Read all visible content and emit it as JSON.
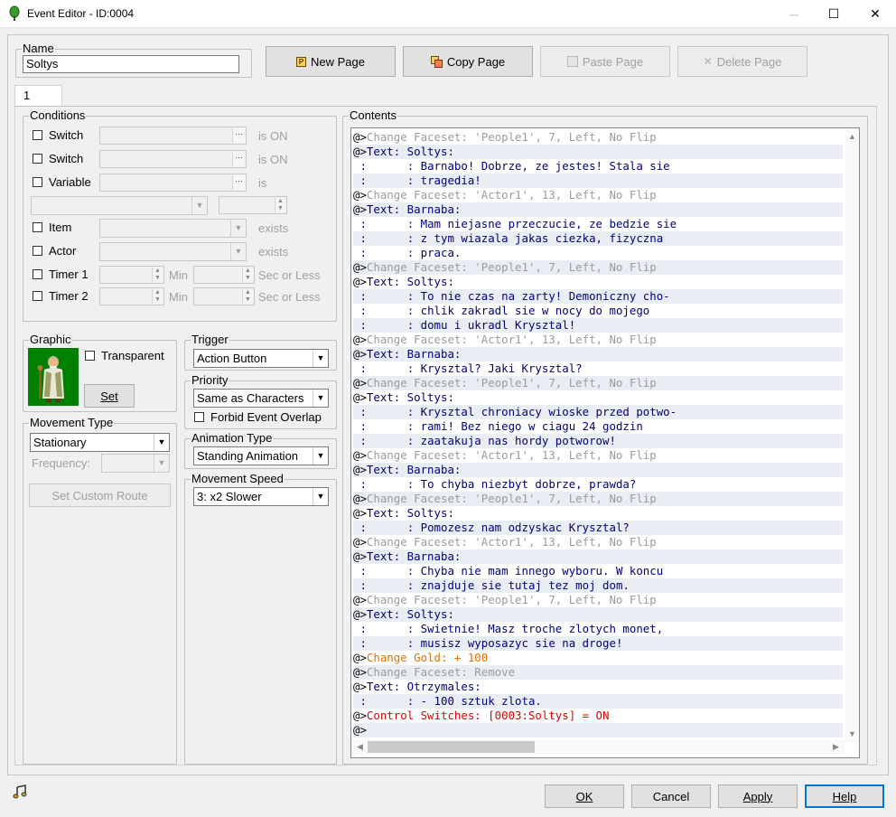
{
  "window": {
    "title": "Event Editor - ID:0004",
    "min": "─",
    "max": "☐",
    "close": "✕"
  },
  "name": {
    "label": "Name",
    "value": "Soltys"
  },
  "toolbar": {
    "new_page": "New Page",
    "copy_page": "Copy Page",
    "paste_page": "Paste Page",
    "delete_page": "Delete Page"
  },
  "tabs": [
    "1"
  ],
  "conditions": {
    "label": "Conditions",
    "switch": "Switch",
    "is_on": "is ON",
    "variable": "Variable",
    "is": "is",
    "item": "Item",
    "exists": "exists",
    "actor": "Actor",
    "timer1": "Timer 1",
    "timer2": "Timer 2",
    "min": "Min",
    "sec": "Sec or Less"
  },
  "graphic": {
    "label": "Graphic",
    "transparent": "Transparent",
    "set": "Set"
  },
  "trigger": {
    "label": "Trigger",
    "value": "Action Button"
  },
  "priority": {
    "label": "Priority",
    "value": "Same as Characters",
    "forbid": "Forbid Event Overlap"
  },
  "animation": {
    "label": "Animation Type",
    "value": "Standing Animation"
  },
  "speed": {
    "label": "Movement Speed",
    "value": "3: x2 Slower"
  },
  "movement": {
    "label": "Movement Type",
    "value": "Stationary",
    "frequency": "Frequency:",
    "custom_route": "Set Custom Route"
  },
  "contents": {
    "label": "Contents",
    "lines": [
      [
        "@>",
        "Change Faceset: 'People1', 7, Left, No Flip",
        "g"
      ],
      [
        "@>",
        "Text: Soltys:",
        "t"
      ],
      [
        " :      ",
        ": Barnabo! Dobrze, ze jestes! Stala sie",
        "t"
      ],
      [
        " :      ",
        ": tragedia!",
        "t"
      ],
      [
        "@>",
        "Change Faceset: 'Actor1', 13, Left, No Flip",
        "g"
      ],
      [
        "@>",
        "Text: Barnaba:",
        "t"
      ],
      [
        " :      ",
        ": Mam niejasne przeczucie, ze bedzie sie",
        "t"
      ],
      [
        " :      ",
        ": z tym wiazala jakas ciezka, fizyczna",
        "t"
      ],
      [
        " :      ",
        ": praca.",
        "t"
      ],
      [
        "@>",
        "Change Faceset: 'People1', 7, Left, No Flip",
        "g"
      ],
      [
        "@>",
        "Text: Soltys:",
        "t"
      ],
      [
        " :      ",
        ": To nie czas na zarty! Demoniczny cho-",
        "t"
      ],
      [
        " :      ",
        ": chlik zakradl sie w nocy do mojego",
        "t"
      ],
      [
        " :      ",
        ": domu i ukradl Krysztal!",
        "t"
      ],
      [
        "@>",
        "Change Faceset: 'Actor1', 13, Left, No Flip",
        "g"
      ],
      [
        "@>",
        "Text: Barnaba:",
        "t"
      ],
      [
        " :      ",
        ": Krysztal? Jaki Krysztal?",
        "t"
      ],
      [
        "@>",
        "Change Faceset: 'People1', 7, Left, No Flip",
        "g"
      ],
      [
        "@>",
        "Text: Soltys:",
        "t"
      ],
      [
        " :      ",
        ": Krysztal chroniacy wioske przed potwo-",
        "t"
      ],
      [
        " :      ",
        ": rami! Bez niego w ciagu 24 godzin",
        "t"
      ],
      [
        " :      ",
        ": zaatakuja nas hordy potworow!",
        "t"
      ],
      [
        "@>",
        "Change Faceset: 'Actor1', 13, Left, No Flip",
        "g"
      ],
      [
        "@>",
        "Text: Barnaba:",
        "t"
      ],
      [
        " :      ",
        ": To chyba niezbyt dobrze, prawda?",
        "t"
      ],
      [
        "@>",
        "Change Faceset: 'People1', 7, Left, No Flip",
        "g"
      ],
      [
        "@>",
        "Text: Soltys:",
        "t"
      ],
      [
        " :      ",
        ": Pomozesz nam odzyskac Krysztal?",
        "t"
      ],
      [
        "@>",
        "Change Faceset: 'Actor1', 13, Left, No Flip",
        "g"
      ],
      [
        "@>",
        "Text: Barnaba:",
        "t"
      ],
      [
        " :      ",
        ": Chyba nie mam innego wyboru. W koncu",
        "t"
      ],
      [
        " :      ",
        ": znajduje sie tutaj tez moj dom.",
        "t"
      ],
      [
        "@>",
        "Change Faceset: 'People1', 7, Left, No Flip",
        "g"
      ],
      [
        "@>",
        "Text: Soltys:",
        "t"
      ],
      [
        " :      ",
        ": Swietnie! Masz troche zlotych monet,",
        "t"
      ],
      [
        " :      ",
        ": musisz wyposazyc sie na droge!",
        "t"
      ],
      [
        "@>",
        "Change Gold: + 100",
        "o"
      ],
      [
        "@>",
        "Change Faceset: Remove",
        "g"
      ],
      [
        "@>",
        "Text: Otrzymales:",
        "t"
      ],
      [
        " :      ",
        ": - 100 sztuk zlota.",
        "t"
      ],
      [
        "@>",
        "Control Switches: [0003:Soltys] = ON",
        "r"
      ],
      [
        "@>",
        "",
        "t"
      ]
    ]
  },
  "footer": {
    "ok": "OK",
    "cancel": "Cancel",
    "apply": "Apply",
    "help": "Help"
  },
  "colors": {
    "gray_cmd": "#9c9c9c",
    "text_cmd": "#000080",
    "gold_cmd": "#e07000",
    "switch_cmd": "#e00000",
    "focus": "#0078d7"
  }
}
